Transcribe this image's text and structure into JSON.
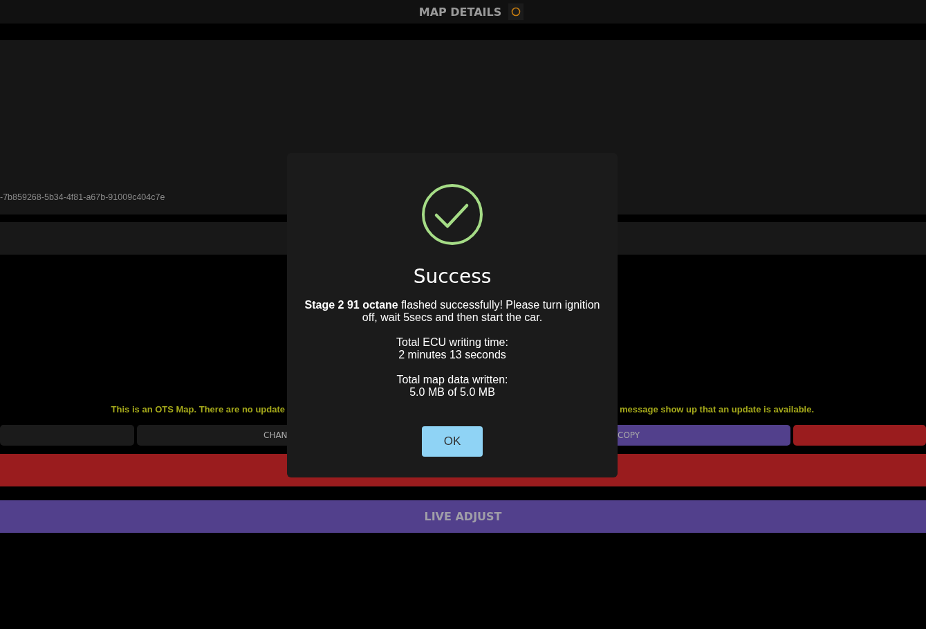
{
  "header": {
    "title": "MAP DETAILS"
  },
  "details": {
    "map_id": "-7b859268-5b34-4f81-a67b-91009c404c7e"
  },
  "notice": {
    "left": "This is an OTS Map. There are no update",
    "right": "message show up that an update is available."
  },
  "actions": [
    {
      "kind": "dark"
    },
    {
      "kind": "dark",
      "label": "CHAN"
    },
    {
      "kind": "purple",
      "label": "COPY"
    },
    {
      "kind": "red"
    }
  ],
  "flash_bar": {
    "kind": "red"
  },
  "live_adjust": {
    "label": "LIVE ADJUST"
  },
  "dialog": {
    "title": "Success",
    "message": "**Stage 2 91 octane** flashed successfully! Please turn ignition off, wait 5secs and then start the car.",
    "lines": [
      [
        "Total ECU writing time:",
        "2 minutes 13 seconds"
      ],
      [
        "Total map data written:",
        "5.0 MB of 5.0 MB"
      ]
    ],
    "button": "OK"
  }
}
